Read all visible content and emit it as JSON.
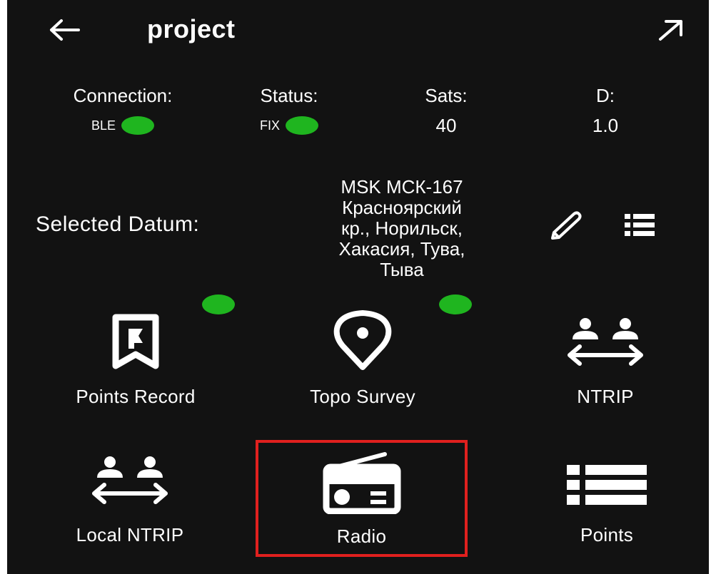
{
  "header": {
    "title": "project",
    "back_icon": "arrow-left-icon",
    "expand_icon": "arrow-up-right-icon"
  },
  "status": {
    "connection": {
      "label": "Connection:",
      "value": "BLE",
      "indicator_color": "#1fb51f"
    },
    "status": {
      "label": "Status:",
      "value": "FIX",
      "indicator_color": "#1fb51f"
    },
    "sats": {
      "label": "Sats:",
      "value": "40"
    },
    "d": {
      "label": "D:",
      "value": "1.0"
    }
  },
  "datum": {
    "label": "Selected Datum:",
    "lines": [
      "MSK МСК-167",
      "Красноярский",
      "кр., Норильск,",
      "Хакасия, Тува,",
      "Тыва"
    ],
    "edit_icon": "pencil-icon",
    "list_icon": "list-icon"
  },
  "tiles": [
    {
      "label": "Points Record",
      "icon": "flag-bookmark-icon",
      "active_indicator": true
    },
    {
      "label": "Topo Survey",
      "icon": "location-pin-icon",
      "active_indicator": true
    },
    {
      "label": "NTRIP",
      "icon": "users-transfer-icon",
      "active_indicator": false
    },
    {
      "label": "Local NTRIP",
      "icon": "users-transfer-icon",
      "active_indicator": false
    },
    {
      "label": "Radio",
      "icon": "radio-icon",
      "active_indicator": false,
      "highlighted": true
    },
    {
      "label": "Points",
      "icon": "list-icon",
      "active_indicator": false
    }
  ],
  "colors": {
    "background": "#121212",
    "text": "#ffffff",
    "indicator": "#1fb51f",
    "highlight_border": "#e0201e"
  }
}
